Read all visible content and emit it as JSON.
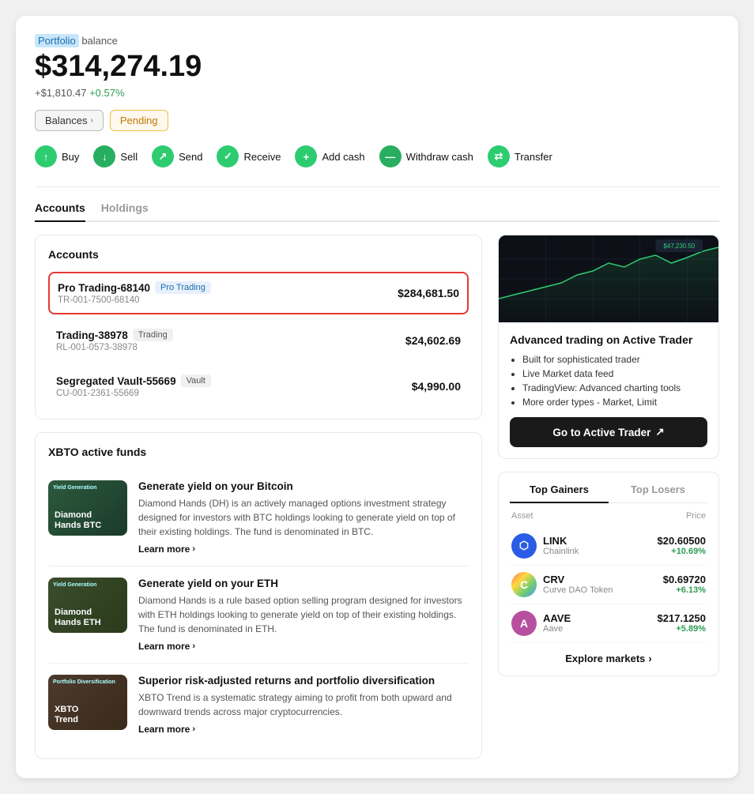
{
  "header": {
    "portfolio_label_prefix": "Portfolio",
    "portfolio_label_suffix": " balance",
    "balance": "$314,274.19",
    "change_amount": "+$1,810.47",
    "change_pct": "+0.57%"
  },
  "balance_tabs": [
    {
      "label": "Balances",
      "type": "active",
      "has_chevron": true
    },
    {
      "label": "Pending",
      "type": "pending"
    }
  ],
  "actions": [
    {
      "label": "Buy",
      "icon": "↑"
    },
    {
      "label": "Sell",
      "icon": "↓"
    },
    {
      "label": "Send",
      "icon": "↗"
    },
    {
      "label": "Receive",
      "icon": "✓"
    },
    {
      "label": "Add cash",
      "icon": "+"
    },
    {
      "label": "Withdraw cash",
      "icon": "—"
    },
    {
      "label": "Transfer",
      "icon": "⇄"
    }
  ],
  "main_tabs": [
    {
      "label": "Accounts",
      "active": true
    },
    {
      "label": "Holdings",
      "active": false
    }
  ],
  "accounts_section": {
    "title": "Accounts",
    "accounts": [
      {
        "name": "Pro Trading-68140",
        "badge": "Pro Trading",
        "badge_type": "pro",
        "id": "TR-001-7500-68140",
        "balance": "$284,681.50",
        "highlighted": true
      },
      {
        "name": "Trading-38978",
        "badge": "Trading",
        "badge_type": "trading",
        "id": "RL-001-0573-38978",
        "balance": "$24,602.69",
        "highlighted": false
      },
      {
        "name": "Segregated Vault-55669",
        "badge": "Vault",
        "badge_type": "vault",
        "id": "CU-001-2361-55669",
        "balance": "$4,990.00",
        "highlighted": false
      }
    ]
  },
  "xbto_section": {
    "title": "XBTO active funds",
    "funds": [
      {
        "thumb_type": "btc",
        "thumb_tag": "Yield Generation",
        "thumb_label": "Diamond\nHands BTC",
        "title": "Generate yield on your Bitcoin",
        "desc": "Diamond Hands (DH) is an actively managed options investment strategy designed for investors with BTC holdings looking to generate yield on top of their existing holdings. The fund is denominated in BTC.",
        "learn_more": "Learn more"
      },
      {
        "thumb_type": "eth",
        "thumb_tag": "Yield Generation",
        "thumb_label": "Diamond\nHands ETH",
        "title": "Generate yield on your ETH",
        "desc": "Diamond Hands is a rule based option selling program designed for investors with ETH holdings looking to generate yield on top of their existing holdings. The fund is denominated in ETH.",
        "learn_more": "Learn more"
      },
      {
        "thumb_type": "portfolio",
        "thumb_tag": "Portfolio Diversification",
        "thumb_label": "XBTO\nTrend",
        "title": "Superior risk-adjusted returns and portfolio diversification",
        "desc": "XBTO Trend is a systematic strategy aiming to profit from both upward and downward trends across major cryptocurrencies.",
        "learn_more": "Learn more"
      }
    ]
  },
  "right_panel": {
    "trader_title": "Advanced trading on Active Trader",
    "trader_features": [
      "Built for sophisticated trader",
      "Live Market data feed",
      "TradingView: Advanced charting tools",
      "More order types - Market, Limit"
    ],
    "go_trader_label": "Go to Active Trader",
    "gainers_tabs": [
      {
        "label": "Top Gainers",
        "active": true
      },
      {
        "label": "Top Losers",
        "active": false
      }
    ],
    "gainers_header_asset": "Asset",
    "gainers_header_price": "Price",
    "gainers": [
      {
        "symbol": "LINK",
        "name": "Chainlink",
        "icon_type": "link",
        "icon_letter": "⬡",
        "price": "$20.60500",
        "pct": "+10.69%"
      },
      {
        "symbol": "CRV",
        "name": "Curve DAO Token",
        "icon_type": "crv",
        "icon_letter": "C",
        "price": "$0.69720",
        "pct": "+6.13%"
      },
      {
        "symbol": "AAVE",
        "name": "Aave",
        "icon_type": "aave",
        "icon_letter": "A",
        "price": "$217.1250",
        "pct": "+5.89%"
      }
    ],
    "explore_markets": "Explore markets"
  }
}
